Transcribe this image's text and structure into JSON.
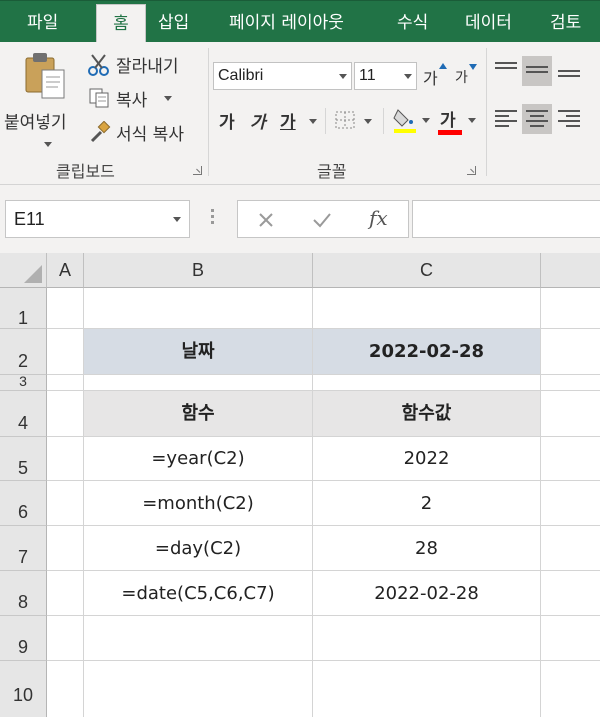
{
  "tabs": [
    {
      "label": "파일",
      "active": false
    },
    {
      "label": "홈",
      "active": true
    },
    {
      "label": "삽입",
      "active": false
    },
    {
      "label": "페이지 레이아웃",
      "active": false
    },
    {
      "label": "수식",
      "active": false
    },
    {
      "label": "데이터",
      "active": false
    },
    {
      "label": "검토",
      "active": false
    }
  ],
  "clipboard": {
    "paste": "붙여넣기",
    "cut": "잘라내기",
    "copy": "복사",
    "format_painter": "서식 복사",
    "group_label": "클립보드"
  },
  "font": {
    "name": "Calibri",
    "size": "11",
    "grow": "가",
    "shrink": "가",
    "bold": "가",
    "italic": "가",
    "underline": "가",
    "color_glyph": "가",
    "group_label": "글꼴"
  },
  "formula_bar": {
    "name_box": "E11",
    "fx": "fx",
    "formula": ""
  },
  "columns": [
    "A",
    "B",
    "C"
  ],
  "rows": [
    {
      "num": "1",
      "b": "",
      "c": ""
    },
    {
      "num": "2",
      "b": "날짜",
      "c": "2022-02-28"
    },
    {
      "num": "3",
      "b": "",
      "c": ""
    },
    {
      "num": "4",
      "b": "함수",
      "c": "함수값"
    },
    {
      "num": "5",
      "b": "=year(C2)",
      "c": "2022"
    },
    {
      "num": "6",
      "b": "=month(C2)",
      "c": "2"
    },
    {
      "num": "7",
      "b": "=day(C2)",
      "c": "28"
    },
    {
      "num": "8",
      "b": "=date(C5,C6,C7)",
      "c": "2022-02-28"
    },
    {
      "num": "9",
      "b": "",
      "c": ""
    },
    {
      "num": "10",
      "b": "",
      "c": ""
    }
  ],
  "colors": {
    "ribbon_tab_bg": "#217346",
    "header_fill": "#d6dce4",
    "subheader_fill": "#e7e6e6",
    "font_color_bar": "#ff0000"
  }
}
